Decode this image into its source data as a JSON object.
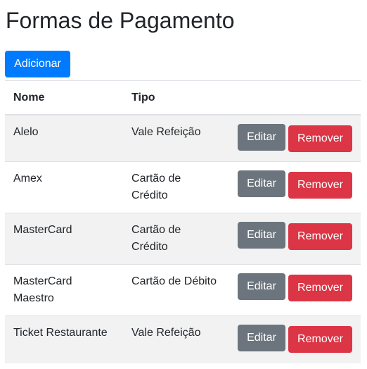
{
  "page": {
    "title": "Formas de Pagamento",
    "add_button": "Adicionar"
  },
  "table": {
    "headers": {
      "nome": "Nome",
      "tipo": "Tipo"
    },
    "rows": [
      {
        "nome": "Alelo",
        "tipo": "Vale Refeição",
        "edit": "Editar",
        "remove": "Remover"
      },
      {
        "nome": "Amex",
        "tipo": "Cartão de Crédito",
        "edit": "Editar",
        "remove": "Remover"
      },
      {
        "nome": "MasterCard",
        "tipo": "Cartão de Crédito",
        "edit": "Editar",
        "remove": "Remover"
      },
      {
        "nome": "MasterCard Maestro",
        "tipo": "Cartão de Débito",
        "edit": "Editar",
        "remove": "Remover"
      },
      {
        "nome": "Ticket Restaurante",
        "tipo": "Vale Refeição",
        "edit": "Editar",
        "remove": "Remover"
      }
    ]
  },
  "colors": {
    "primary": "#007bff",
    "secondary": "#6c757d",
    "danger": "#dc3545",
    "stripe": "#f2f2f2"
  }
}
